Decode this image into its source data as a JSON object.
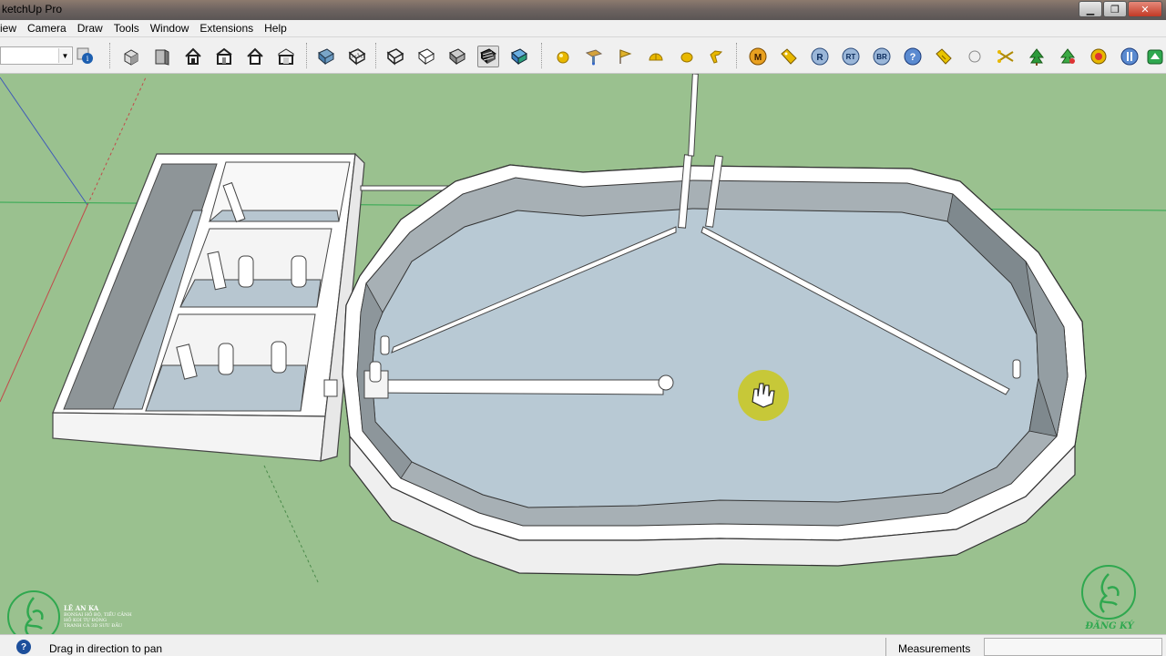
{
  "window": {
    "title": "ketchUp Pro",
    "buttons": {
      "minimize": "▁",
      "restore": "❐",
      "close": "✕"
    }
  },
  "menu": [
    "iew",
    "Camera",
    "Draw",
    "Tools",
    "Window",
    "Extensions",
    "Help"
  ],
  "toolbar": {
    "combo_value": "",
    "icons": {
      "view_group": [
        "iso-view-icon",
        "top-view-icon",
        "front-view-icon",
        "right-view-icon",
        "back-view-icon",
        "left-view-icon"
      ],
      "style_group": [
        "xray-icon",
        "back-edges-icon",
        "wireframe-icon",
        "hidden-line-icon",
        "shaded-icon",
        "shaded-textures-icon",
        "monochrome-icon"
      ],
      "sandbox_group": [
        "sphere-icon",
        "section-plane-icon",
        "flag-icon",
        "dome-icon",
        "ball-icon",
        "hand-pointer-icon"
      ],
      "plugin_group": [
        "M",
        "tag-icon",
        "R",
        "RT",
        "BR",
        "?",
        "price-tag-icon",
        "dot-icon",
        "scissors-icon",
        "tree-icon",
        "tree-alt-icon",
        "target-icon",
        "pause-icon"
      ]
    }
  },
  "status": {
    "help_icon": "?",
    "message": "Drag in direction to pan",
    "measurements_label": "Measurements",
    "measurements_value": ""
  },
  "watermark_left": {
    "name": "LÊ AN KA",
    "lines": [
      "BONSAI HỒ BỘ, TIỂU CẢNH",
      "HỒ KOI TỰ ĐỘNG",
      "TRANH CÁ 3D SƯU ĐẦU"
    ]
  },
  "watermark_right": {
    "label": "ĐĂNG KÝ"
  },
  "colors": {
    "viewport": "#9ac18f",
    "water": "#b8c9d4",
    "wall": "#ffffff",
    "wall_inner": "#9fa8ae",
    "cursor_halo": "#c9c81c",
    "watermark": "#2fa84f"
  }
}
